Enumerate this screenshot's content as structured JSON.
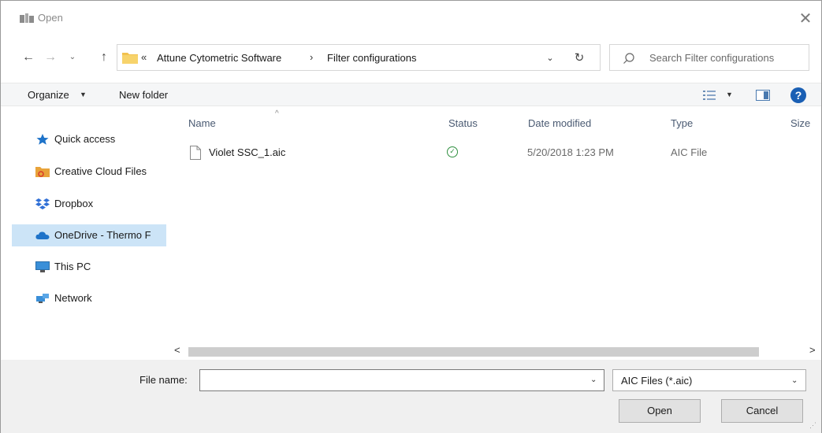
{
  "window": {
    "title": "Open",
    "close_glyph": "✕"
  },
  "address": {
    "overflow_glyph": "«",
    "breadcrumbs": [
      "Attune Cytometric Software",
      "Filter configurations"
    ],
    "separator": "›"
  },
  "search": {
    "placeholder": "Search Filter configurations"
  },
  "toolbar": {
    "organize_label": "Organize",
    "new_folder_label": "New folder",
    "help_glyph": "?"
  },
  "sidebar": {
    "items": [
      {
        "label": "Quick access",
        "icon": "star-icon",
        "color": "#1e73c9"
      },
      {
        "label": "Creative Cloud Files",
        "icon": "creative-cloud-folder-icon",
        "color": "#e8a33a"
      },
      {
        "label": "Dropbox",
        "icon": "dropbox-icon",
        "color": "#2f6fd6"
      },
      {
        "label": "OneDrive - Thermo F",
        "icon": "onedrive-cloud-icon",
        "color": "#1e73c9",
        "selected": true
      },
      {
        "label": "This PC",
        "icon": "computer-icon",
        "color": "#3a8fd8"
      },
      {
        "label": "Network",
        "icon": "network-icon",
        "color": "#3a8fd8"
      }
    ]
  },
  "file_list": {
    "columns": [
      "Name",
      "Status",
      "Date modified",
      "Type",
      "Size"
    ],
    "rows": [
      {
        "name": "Violet SSC_1.aic",
        "status": "synced",
        "date_modified": "5/20/2018 1:23 PM",
        "type": "AIC File"
      }
    ]
  },
  "footer": {
    "file_name_label": "File name:",
    "file_name_value": "",
    "file_type": "AIC Files (*.aic)",
    "open_label": "Open",
    "cancel_label": "Cancel"
  },
  "colors": {
    "accent": "#1a5fb4",
    "selection": "#cce4f7",
    "status_ok": "#2f8f3f"
  }
}
